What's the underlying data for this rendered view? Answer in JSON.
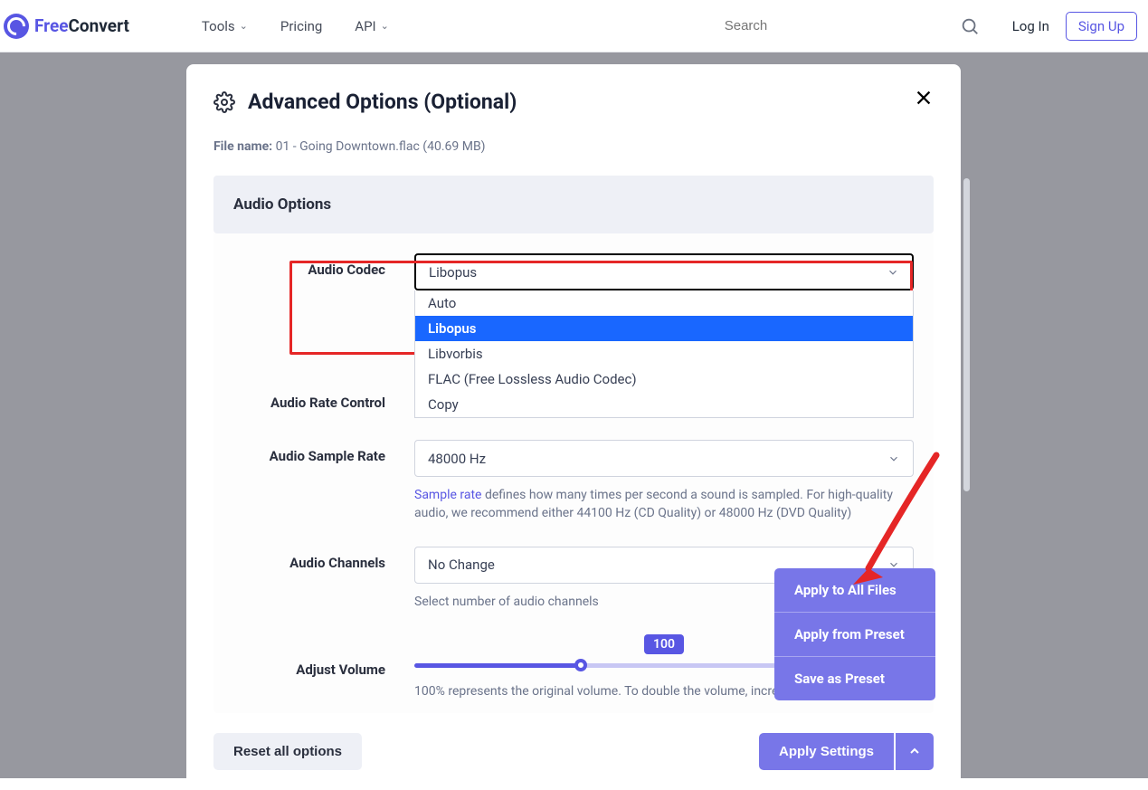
{
  "header": {
    "logo_free": "Free",
    "logo_convert": "Convert",
    "nav": {
      "tools": "Tools",
      "pricing": "Pricing",
      "api": "API"
    },
    "search_placeholder": "Search",
    "login": "Log In",
    "signup": "Sign Up"
  },
  "modal": {
    "title": "Advanced Options (Optional)",
    "filename_label": "File name:",
    "filename_value": "01 - Going Downtown.flac (40.69 MB)",
    "section_audio": "Audio Options",
    "labels": {
      "codec": "Audio Codec",
      "rate_control": "Audio Rate Control",
      "sample_rate": "Audio Sample Rate",
      "channels": "Audio Channels",
      "volume": "Adjust Volume"
    },
    "codec": {
      "value": "Libopus",
      "options": [
        "Auto",
        "Libopus",
        "Libvorbis",
        "FLAC (Free Lossless Audio Codec)",
        "Copy"
      ]
    },
    "sample_rate": {
      "value": "48000 Hz",
      "help_link": "Sample rate",
      "help_rest": " defines how many times per second a sound is sampled. For high-quality audio, we recommend either 44100 Hz (CD Quality) or 48000 Hz (DVD Quality)"
    },
    "channels": {
      "value": "No Change",
      "help": "Select number of audio channels"
    },
    "volume": {
      "value": "100",
      "help": "100% represents the original volume. To double the volume, incre"
    },
    "footer": {
      "reset": "Reset all options",
      "apply": "Apply Settings"
    },
    "float_menu": [
      "Apply to All Files",
      "Apply from Preset",
      "Save as Preset"
    ]
  }
}
